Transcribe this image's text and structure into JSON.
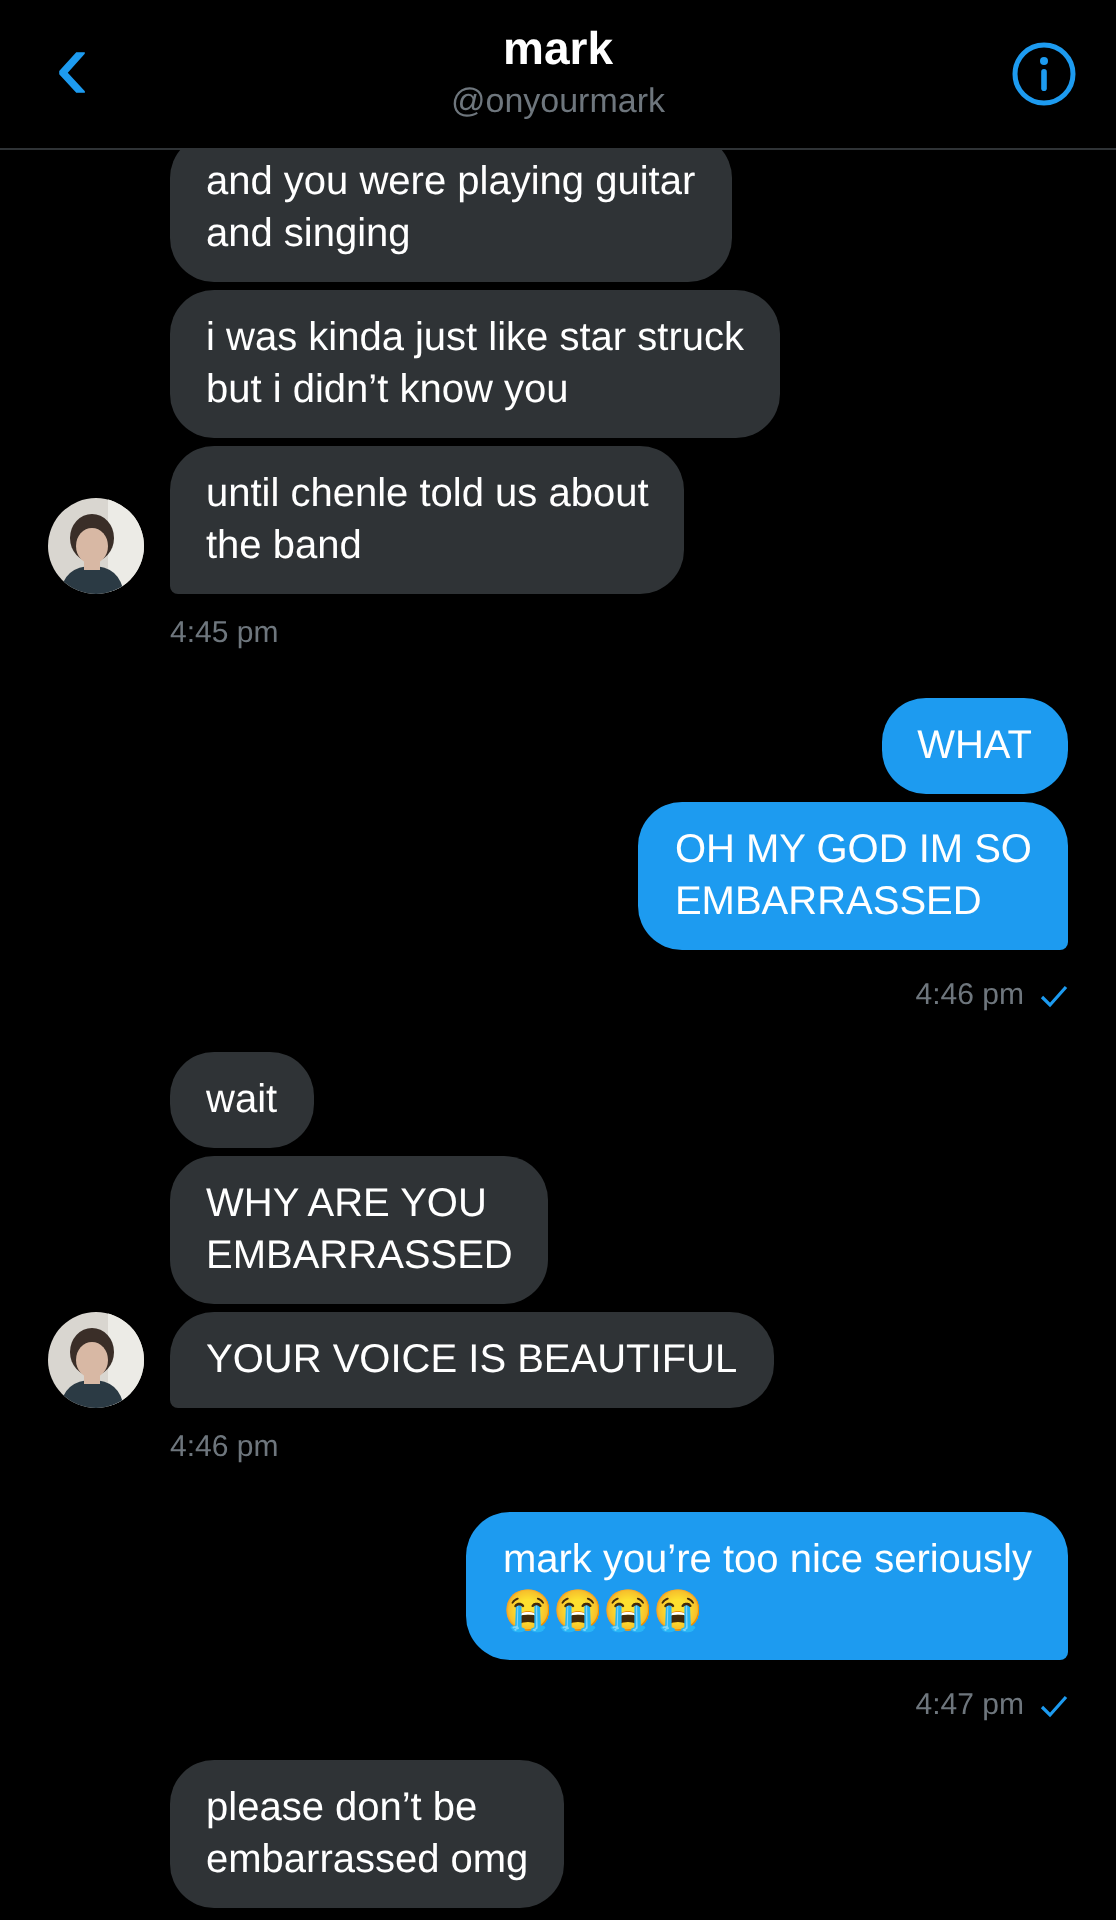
{
  "header": {
    "back": "‹",
    "name": "mark",
    "handle": "@onyourmark"
  },
  "groups": [
    {
      "kind": "received",
      "messages": [
        "and you were playing guitar\nand singing",
        "i was kinda just like star struck\nbut i didn’t know you",
        "until chenle told us about\nthe band"
      ],
      "time": "4:45 pm"
    },
    {
      "kind": "sent",
      "messages": [
        "WHAT",
        "OH MY GOD IM SO\nEMBARRASSED"
      ],
      "time": "4:46 pm",
      "read": true
    },
    {
      "kind": "received",
      "messages": [
        "wait",
        "WHY ARE YOU\nEMBARRASSED",
        "YOUR VOICE IS BEAUTIFUL"
      ],
      "time": "4:46 pm"
    },
    {
      "kind": "sent",
      "messages": [
        "mark you’re too nice seriously\n😭😭😭😭"
      ],
      "time": "4:47 pm",
      "read": true
    },
    {
      "kind": "received",
      "messages": [
        "please don’t be\nembarrassed omg"
      ]
    }
  ]
}
